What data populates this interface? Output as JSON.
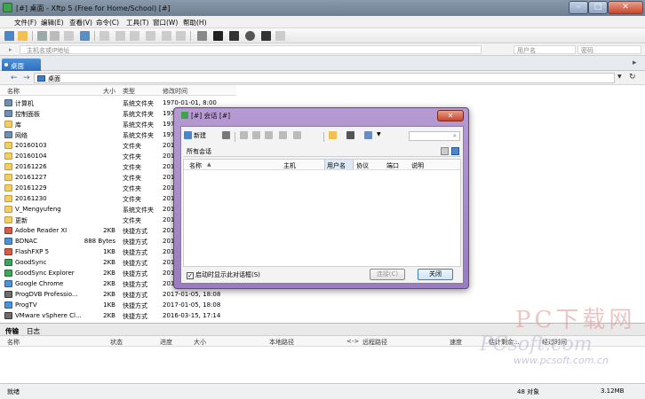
{
  "window": {
    "title": "[#] 桌面 - Xftp 5 (Free for Home/School) [#]",
    "min_glyph": "–",
    "max_glyph": "□",
    "close_glyph": "✕"
  },
  "menu": [
    "文件(F)",
    "编辑(E)",
    "查看(V)",
    "命令(C)",
    "工具(T)",
    "窗口(W)",
    "帮助(H)"
  ],
  "address": {
    "host_placeholder": "主机名或IP地址",
    "user_placeholder": "用户名",
    "pass_placeholder": "密码"
  },
  "session_tab": "桌面",
  "nav": {
    "back": "←",
    "forward": "→",
    "path": "桌面",
    "dropdown": "▼",
    "refresh": "↻"
  },
  "columns": {
    "name": "名称",
    "size": "大小",
    "type": "类型",
    "modified": "修改时间"
  },
  "files": [
    {
      "icon": "sys",
      "name": "计算机",
      "size": "",
      "type": "系统文件夹",
      "date": "1970-01-01, 8:00"
    },
    {
      "icon": "sys",
      "name": "控制面板",
      "size": "",
      "type": "系统文件夹",
      "date": "1970-01-01, 8:00"
    },
    {
      "icon": "folder",
      "name": "库",
      "size": "",
      "type": "系统文件夹",
      "date": "1970"
    },
    {
      "icon": "sys",
      "name": "网络",
      "size": "",
      "type": "系统文件夹",
      "date": "1970"
    },
    {
      "icon": "folder",
      "name": "20160103",
      "size": "",
      "type": "文件夹",
      "date": "2016"
    },
    {
      "icon": "folder",
      "name": "20160104",
      "size": "",
      "type": "文件夹",
      "date": "2016"
    },
    {
      "icon": "folder",
      "name": "20161226",
      "size": "",
      "type": "文件夹",
      "date": "2016"
    },
    {
      "icon": "folder",
      "name": "20161227",
      "size": "",
      "type": "文件夹",
      "date": "2017"
    },
    {
      "icon": "folder",
      "name": "20161229",
      "size": "",
      "type": "文件夹",
      "date": "2017"
    },
    {
      "icon": "folder",
      "name": "20161230",
      "size": "",
      "type": "文件夹",
      "date": "2016"
    },
    {
      "icon": "folder",
      "name": "V_Mengyufeng",
      "size": "",
      "type": "系统文件夹",
      "date": "2017"
    },
    {
      "icon": "folder",
      "name": "更新",
      "size": "",
      "type": "文件夹",
      "date": "2017"
    },
    {
      "icon": "app",
      "name": "Adobe Reader XI",
      "size": "2KB",
      "type": "快捷方式",
      "date": "2016"
    },
    {
      "icon": "app2",
      "name": "BDNAC",
      "size": "888 Bytes",
      "type": "快捷方式",
      "date": "2016"
    },
    {
      "icon": "app",
      "name": "FlashFXP 5",
      "size": "1KB",
      "type": "快捷方式",
      "date": "2016"
    },
    {
      "icon": "app3",
      "name": "GoodSync",
      "size": "2KB",
      "type": "快捷方式",
      "date": "2017"
    },
    {
      "icon": "app3",
      "name": "GoodSync Explorer",
      "size": "2KB",
      "type": "快捷方式",
      "date": "2017"
    },
    {
      "icon": "app2",
      "name": "Google Chrome",
      "size": "2KB",
      "type": "快捷方式",
      "date": "2017"
    },
    {
      "icon": "app4",
      "name": "ProgDVB Professio...",
      "size": "2KB",
      "type": "快捷方式",
      "date": "2017-01-05, 18:08"
    },
    {
      "icon": "app2",
      "name": "ProgTV",
      "size": "1KB",
      "type": "快捷方式",
      "date": "2017-01-05, 18:08"
    },
    {
      "icon": "app4",
      "name": "VMware vSphere Cl...",
      "size": "2KB",
      "type": "快捷方式",
      "date": "2016-03-15, 17:14"
    }
  ],
  "bottom": {
    "tabs": [
      "传输",
      "日志"
    ],
    "columns": [
      "名称",
      "状态",
      "进度",
      "大小",
      "本地路径",
      "<->",
      "远程路径",
      "速度",
      "估计剩余...",
      "经过时间"
    ]
  },
  "status": {
    "left": "就绪",
    "count": "48 对象",
    "size": "3.12MB"
  },
  "watermark": {
    "big": "PC下载网",
    "url": "PCsoft.com",
    "url2": "www.pcsoft.com.cn"
  },
  "dialog": {
    "title": "[#] 会话 [#]",
    "close": "✕",
    "new_label": "新建",
    "search_glyph": "⌕",
    "sub_label": "所有会话",
    "columns": [
      "名称",
      "主机",
      "用户名",
      "协议",
      "端口",
      "说明"
    ],
    "sort_glyph": "▲",
    "checkbox_label": "启动时显示此对话框(S)",
    "checked": true,
    "check_glyph": "✓",
    "connect_label": "连接(C)",
    "close_label": "关闭"
  }
}
